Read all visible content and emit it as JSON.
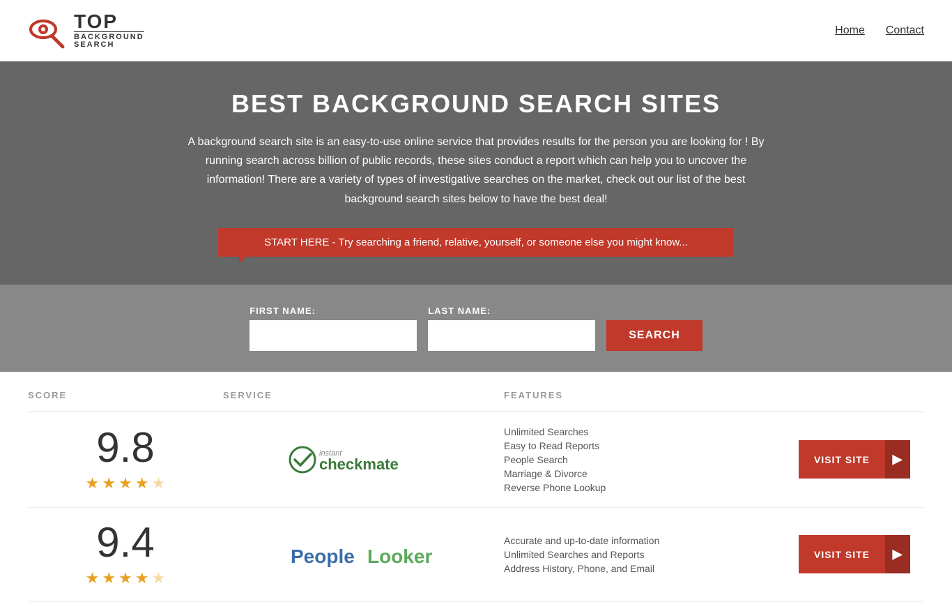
{
  "header": {
    "logo_top": "TOP",
    "logo_bottom": "BACKGROUND\nSEARCH",
    "nav_items": [
      {
        "label": "Home",
        "url": "#"
      },
      {
        "label": "Contact",
        "url": "#"
      }
    ]
  },
  "hero": {
    "title": "BEST BACKGROUND SEARCH SITES",
    "description": "A background search site is an easy-to-use online service that provides results  for the person you are looking for ! By  running  search across billion of public records, these sites conduct  a report which can help you to uncover the information! There are a variety of types of investigative searches on the market, check out our  list of the best background search sites below to have the best deal!",
    "search_banner": "START HERE - Try searching a friend, relative, yourself, or someone else you might know..."
  },
  "search_form": {
    "first_name_label": "FIRST NAME:",
    "last_name_label": "LAST NAME:",
    "search_button": "SEARCH",
    "first_name_placeholder": "",
    "last_name_placeholder": ""
  },
  "table": {
    "headers": {
      "score": "SCORE",
      "service": "SERVICE",
      "features": "FEATURES"
    },
    "rows": [
      {
        "score": "9.8",
        "stars": 4.5,
        "service_name": "Instant Checkmate",
        "features": [
          "Unlimited Searches",
          "Easy to Read Reports",
          "People Search",
          "Marriage & Divorce",
          "Reverse Phone Lookup"
        ],
        "visit_label": "VISIT SITE"
      },
      {
        "score": "9.4",
        "stars": 4,
        "service_name": "PeopleLooker",
        "features": [
          "Accurate and up-to-date information",
          "Unlimited Searches and Reports",
          "Address History, Phone, and Email"
        ],
        "visit_label": "VISIT SITE"
      }
    ]
  }
}
